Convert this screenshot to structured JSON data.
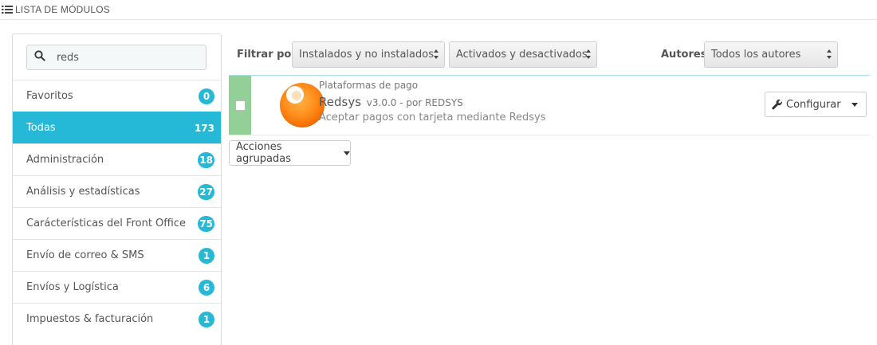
{
  "header": {
    "title": "Lista de módulos",
    "icon": "list-icon"
  },
  "search": {
    "value": "reds",
    "placeholder": ""
  },
  "categories": [
    {
      "label": "Favoritos",
      "count": "0"
    },
    {
      "label": "Todas",
      "count": "173",
      "active": true
    },
    {
      "label": "Administración",
      "count": "18"
    },
    {
      "label": "Análisis y estadísticas",
      "count": "27"
    },
    {
      "label": "Carácterísticas del Front Office",
      "count": "75"
    },
    {
      "label": "Envío de correo & SMS",
      "count": "1"
    },
    {
      "label": "Envíos y Logística",
      "count": "6"
    },
    {
      "label": "Impuestos & facturación",
      "count": "1"
    }
  ],
  "filters": {
    "filter_label": "Filtrar por",
    "installed_select": "Instalados y no instalados",
    "enabled_select": "Activados y desactivados",
    "authors_label": "Autores",
    "authors_select": "Todos los autores"
  },
  "module": {
    "category": "Plataformas de pago",
    "name": "Redsys",
    "version": "v3.0.0 - por REDSYS",
    "description": "Aceptar pagos con tarjeta mediante Redsys",
    "config_label": "Configurar",
    "status_color": "#92d097"
  },
  "bulk_actions": {
    "label": "Acciones agrupadas"
  },
  "colors": {
    "accent": "#25b9d7",
    "installed": "#92d097"
  }
}
